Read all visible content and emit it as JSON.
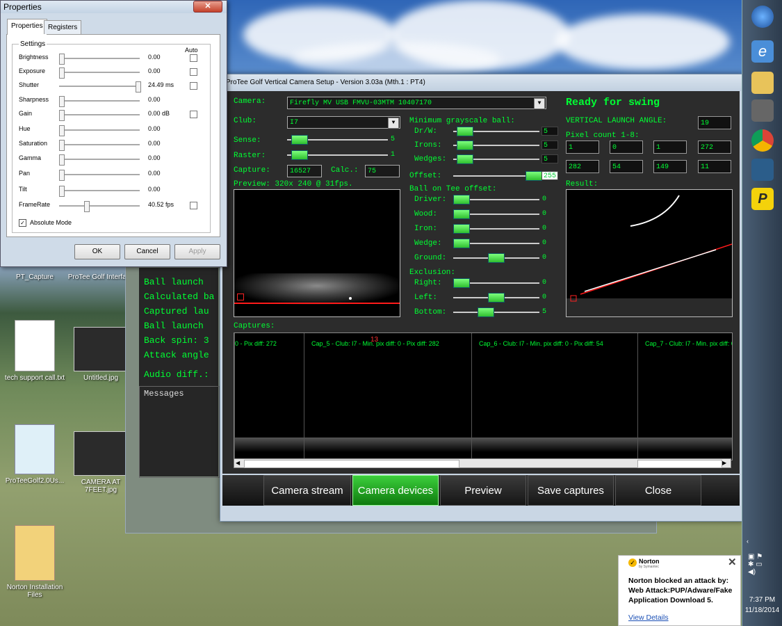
{
  "properties_dialog": {
    "title": "Properties",
    "close_label": "✕",
    "tabs": [
      {
        "label": "Properties"
      },
      {
        "label": "Registers"
      }
    ],
    "settings_legend": "Settings",
    "auto_header": "Auto",
    "rows": [
      {
        "label": "Brightness",
        "value": "0.00",
        "has_auto": true,
        "level": 0
      },
      {
        "label": "Exposure",
        "value": "0.00",
        "has_auto": true,
        "level": 0
      },
      {
        "label": "Shutter",
        "value": "24.49 ms",
        "has_auto": true,
        "level": 1
      },
      {
        "label": "Sharpness",
        "value": "0.00",
        "has_auto": false,
        "level": 0
      },
      {
        "label": "Gain",
        "value": "0.00 dB",
        "has_auto": true,
        "level": 0
      },
      {
        "label": "Hue",
        "value": "0.00",
        "has_auto": false,
        "level": 0
      },
      {
        "label": "Saturation",
        "value": "0.00",
        "has_auto": false,
        "level": 0
      },
      {
        "label": "Gamma",
        "value": "0.00",
        "has_auto": false,
        "level": 0
      },
      {
        "label": "Pan",
        "value": "0.00",
        "has_auto": false,
        "level": 0
      },
      {
        "label": "Tilt",
        "value": "0.00",
        "has_auto": false,
        "level": 0
      },
      {
        "label": "FrameRate",
        "value": "40.52 fps",
        "has_auto": true,
        "level": 0.33
      }
    ],
    "absolute_mode_label": "Absolute Mode",
    "absolute_mode_checked": true,
    "ok_label": "OK",
    "cancel_label": "Cancel",
    "apply_label": "Apply"
  },
  "desktop": {
    "icons": [
      {
        "label": "PT_Capture"
      },
      {
        "label": "ProTee Golf Interface"
      },
      {
        "label": "tech support call.txt"
      },
      {
        "label": "Untitled.jpg"
      },
      {
        "label": "ProTeeGolf2.0Us..."
      },
      {
        "label": "CAMERA AT 7FEET.jpg"
      },
      {
        "label": "Norton Installation Files"
      }
    ]
  },
  "back_window": {
    "lines": [
      "Ball launch ",
      "Calculated ba",
      "Captured lau",
      "Ball launch ",
      "Back spin: 3",
      "Attack angle",
      "Audio diff.:"
    ],
    "messages_label": "Messages"
  },
  "main_window": {
    "title": "ProTee Golf Vertical Camera Setup - Version 3.03a (Mth.1 : PT4)",
    "camera_label": "Camera:",
    "camera_value": "Firefly MV USB FMVU-03MTM 10407170",
    "club_label": "Club:",
    "club_value": "I7",
    "sense_label": "Sense:",
    "sense_value": "5",
    "sense_level": 0.05,
    "raster_label": "Raster:",
    "raster_value": "1",
    "raster_level": 0.05,
    "capture_label": "Capture:",
    "capture_value": "16527",
    "calc_label": "Calc.:",
    "calc_value": "75",
    "preview_label": "Preview: 320x 240 @ 31fps.",
    "min_gray_label": "Minimum grayscale ball:",
    "min_gray": [
      {
        "label": "Dr/W:",
        "value": "5",
        "level": 0.05
      },
      {
        "label": "Irons:",
        "value": "5",
        "level": 0.05
      },
      {
        "label": "Wedges:",
        "value": "5",
        "level": 0.05
      }
    ],
    "offset_label": "Offset:",
    "offset_value": "255",
    "offset_level": 1,
    "tee_offset_label": "Ball on Tee offset:",
    "tee_offset": [
      {
        "label": "Driver:",
        "value": "0",
        "level": 0
      },
      {
        "label": "Wood:",
        "value": "0",
        "level": 0
      },
      {
        "label": "Iron:",
        "value": "0",
        "level": 0
      },
      {
        "label": "Wedge:",
        "value": "0",
        "level": 0
      },
      {
        "label": "Ground:",
        "value": "0",
        "level": 0.5
      }
    ],
    "exclusion_label": "Exclusion:",
    "exclusion": [
      {
        "label": "Right:",
        "value": "0",
        "level": 0
      },
      {
        "label": "Left:",
        "value": "0",
        "level": 0.5
      },
      {
        "label": "Bottom:",
        "value": "5",
        "level": 0.35
      }
    ],
    "status": "Ready for swing",
    "vla_label": "VERTICAL LAUNCH ANGLE:",
    "vla_value": "19",
    "pixel_count_label": "Pixel count 1-8:",
    "pixel_counts": [
      "1",
      "0",
      "1",
      "272",
      "282",
      "54",
      "149",
      "11"
    ],
    "result_label": "Result:",
    "captures_label": "Captures:",
    "captures": [
      {
        "text": "0 - Pix diff: 272"
      },
      {
        "text": "Cap_5 - Club: I7 - Min. pix diff: 0 - Pix diff: 282"
      },
      {
        "text": "Cap_6 - Club: I7 - Min. pix diff: 0 - Pix diff: 54"
      },
      {
        "text": "Cap_7 - Club: I7 - Min. pix diff: 0 - Pix diff:"
      }
    ],
    "capture_marker": "13",
    "buttons": [
      {
        "label": "Camera stream",
        "active": false
      },
      {
        "label": "Camera devices",
        "active": true
      },
      {
        "label": "Preview",
        "active": false
      },
      {
        "label": "Save captures",
        "active": false
      },
      {
        "label": "Close",
        "active": false
      }
    ]
  },
  "norton": {
    "brand": "Norton",
    "brand_sub": "by Symantec",
    "message": "Norton blocked an attack by: Web Attack:PUP/Adware/Fake Application Download 5.",
    "link": "View Details"
  },
  "taskbar": {
    "time": "7:37 PM",
    "date": "11/18/2014"
  }
}
